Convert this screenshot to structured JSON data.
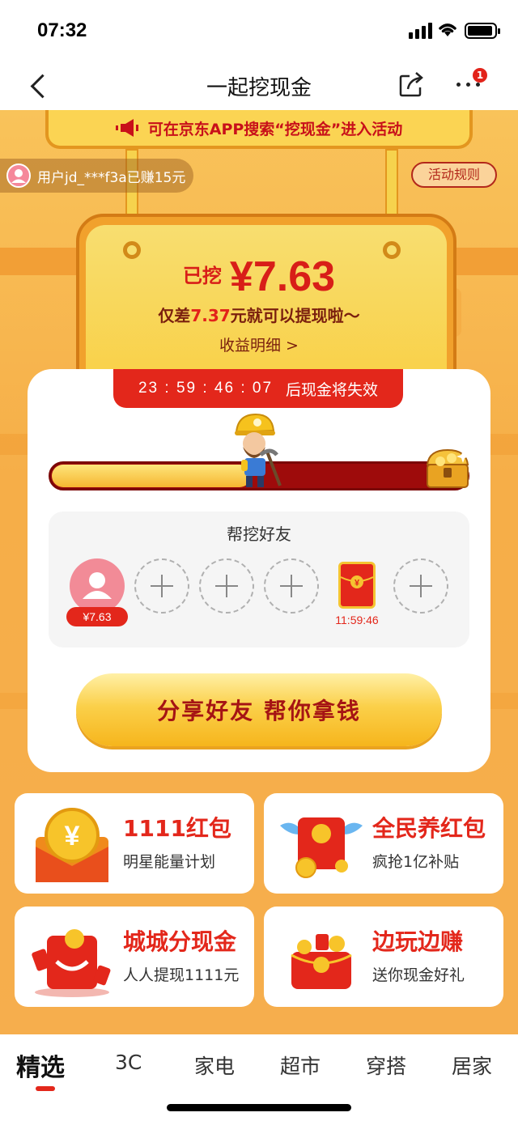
{
  "status": {
    "time": "07:32"
  },
  "nav": {
    "title": "一起挖现金",
    "more_badge": "1"
  },
  "banner": {
    "text": "可在京东APP搜索“挖现金”进入活动"
  },
  "ticker": {
    "text": "用户jd_***f3a已赚15元"
  },
  "rules": {
    "label": "活动规则"
  },
  "board": {
    "earned_label": "已挖",
    "amount": "¥7.63",
    "remain_prefix": "仅差",
    "remain_amount": "7.37",
    "remain_suffix": "元就可以提现啦～",
    "detail_link": "收益明细 >"
  },
  "countdown": {
    "clock": "23 : 59 : 46 : 07",
    "suffix": "后现金将失效"
  },
  "progress": {
    "fraction": 0.48
  },
  "friends": {
    "title": "帮挖好友",
    "friend_amount": "¥7.63",
    "redpack_time": "11:59:46"
  },
  "cta": {
    "label": "分享好友 帮你拿钱"
  },
  "tiles": [
    {
      "title": "1111红包",
      "subtitle": "明星能量计划"
    },
    {
      "title": "全民养红包",
      "subtitle": "疯抢1亿补贴"
    },
    {
      "title": "城城分现金",
      "subtitle": "人人提现1111元"
    },
    {
      "title": "边玩边赚",
      "subtitle": "送你现金好礼"
    }
  ],
  "tabs": [
    "精选",
    "3C",
    "家电",
    "超市",
    "穿搭",
    "居家"
  ],
  "colors": {
    "accent_red": "#e3271b",
    "gold": "#f9cf43",
    "background": "#f7b34a"
  }
}
